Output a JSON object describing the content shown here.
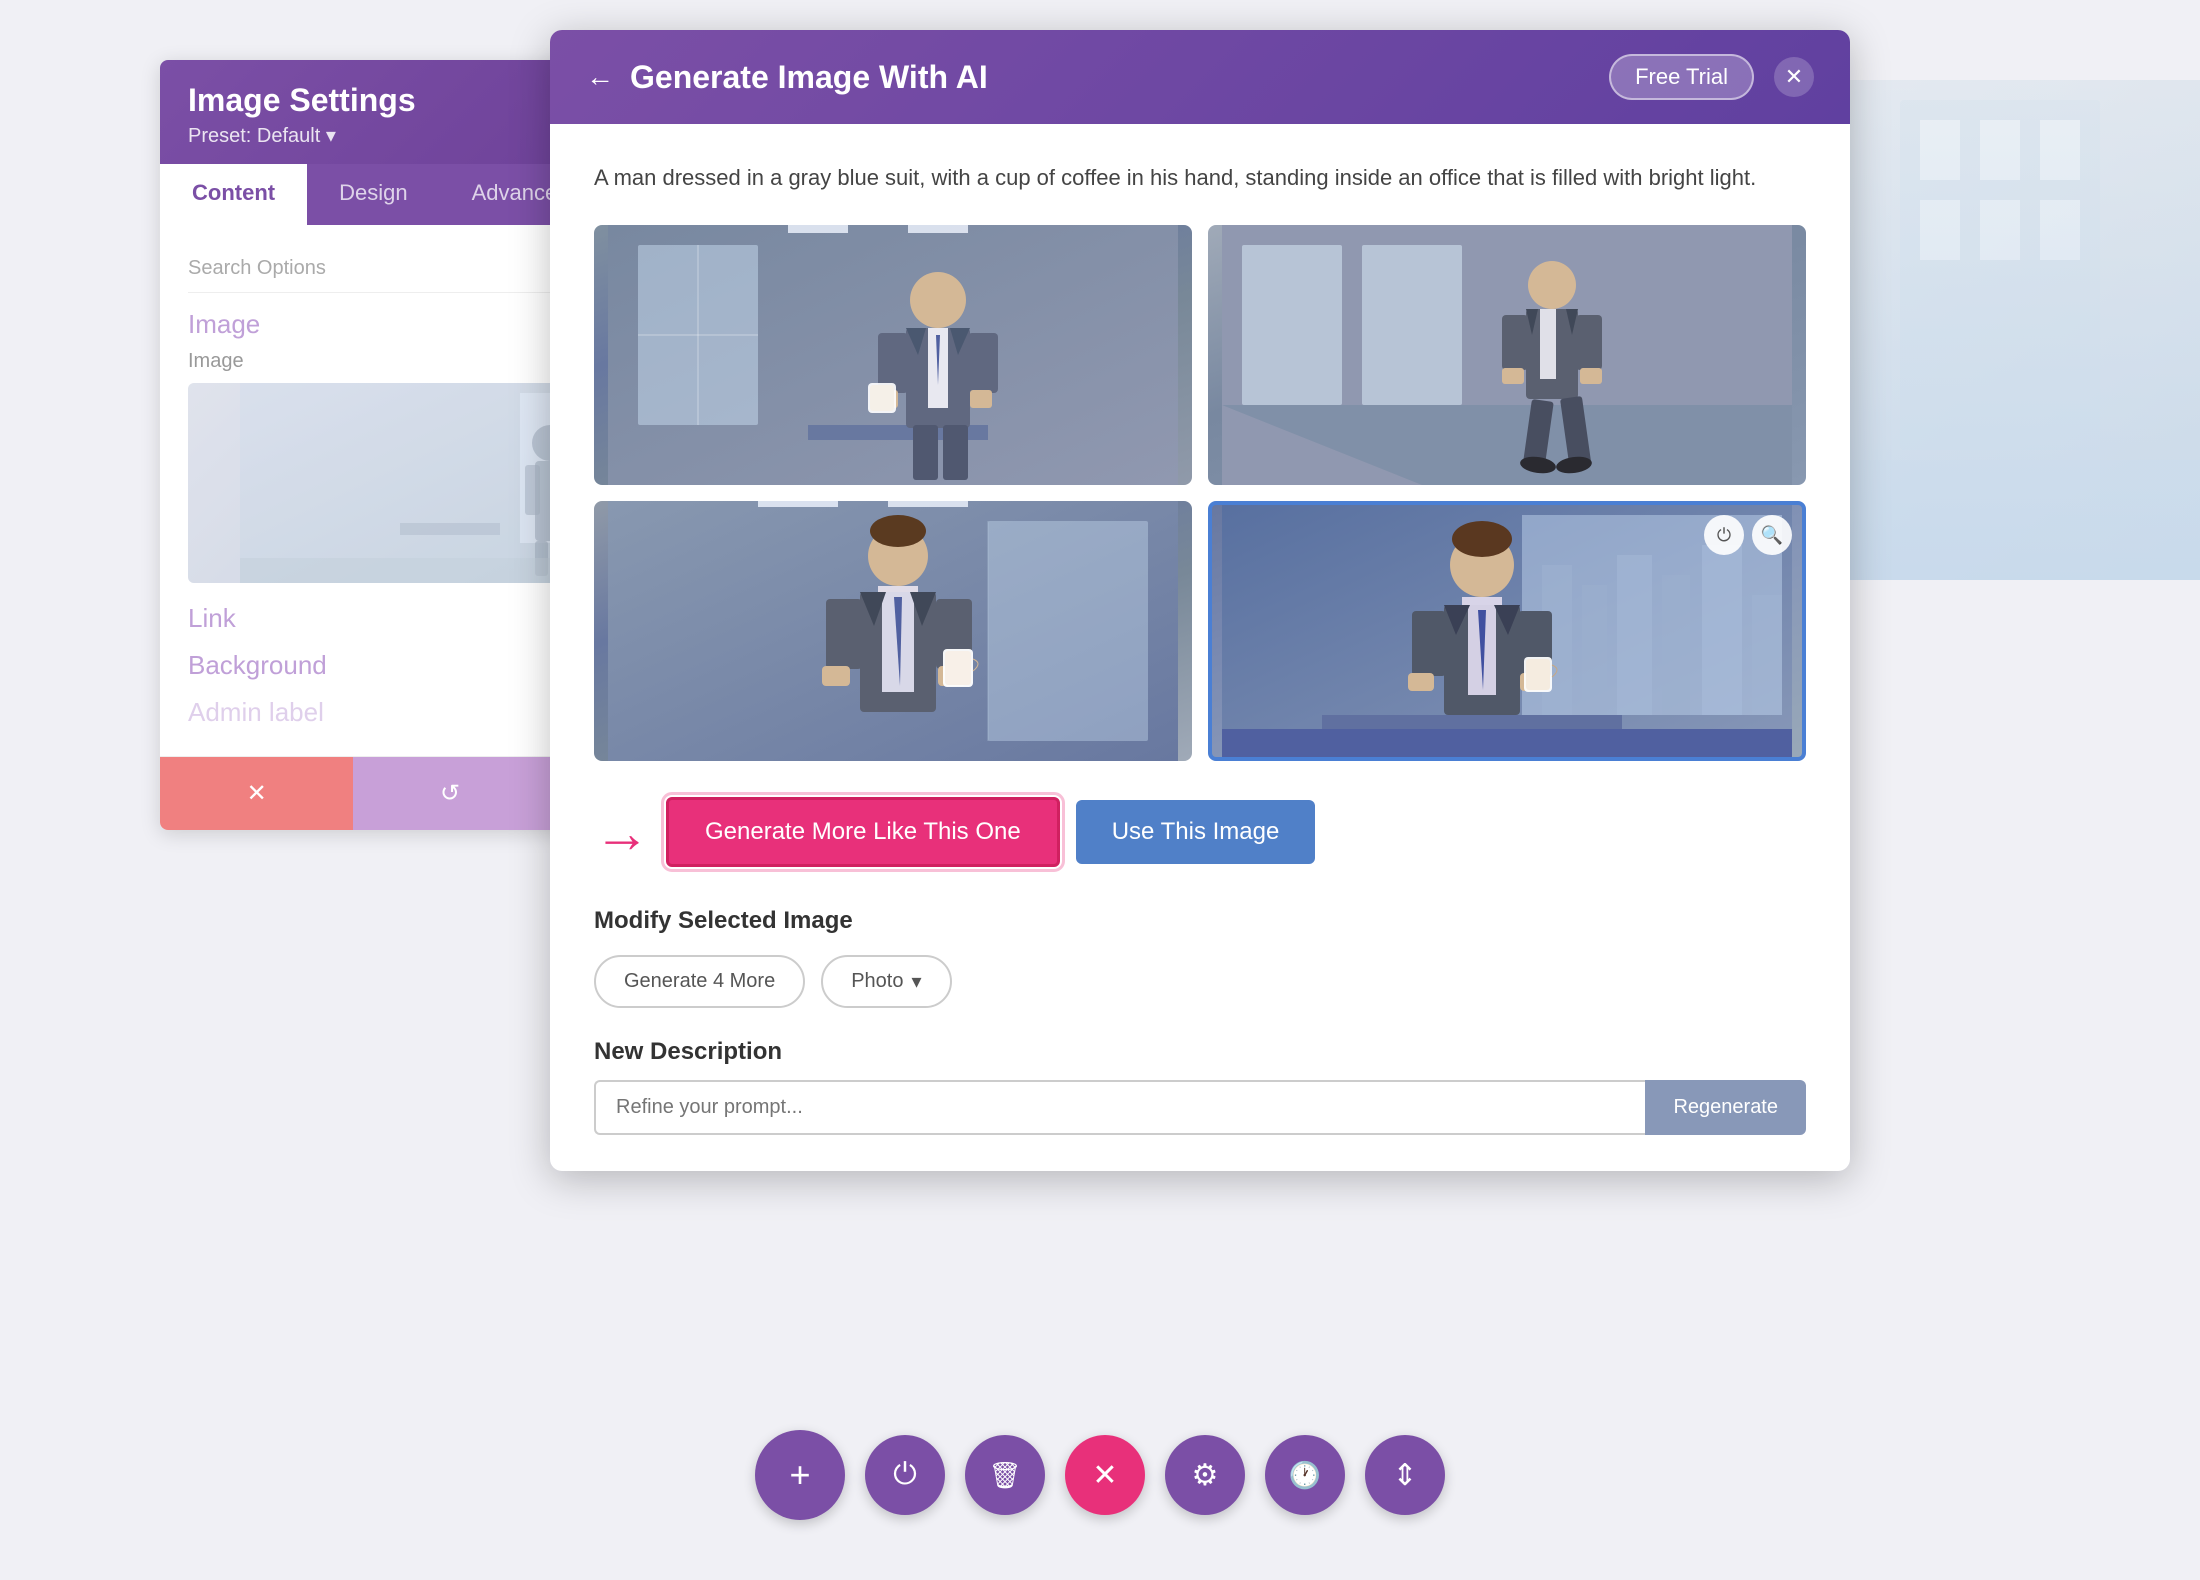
{
  "page": {
    "background_color": "#e8e8f0"
  },
  "image_settings_panel": {
    "title": "Image Settings",
    "preset_label": "Preset: Default",
    "preset_arrow": "▾",
    "tabs": [
      {
        "id": "content",
        "label": "Content",
        "active": true
      },
      {
        "id": "design",
        "label": "Design",
        "active": false
      },
      {
        "id": "advanced",
        "label": "Advanced",
        "active": false
      }
    ],
    "search_placeholder": "Search Options",
    "sections": [
      {
        "id": "image",
        "label": "Image"
      },
      {
        "id": "link",
        "label": "Link"
      },
      {
        "id": "background",
        "label": "Background"
      },
      {
        "id": "admin",
        "label": "Admin label"
      }
    ],
    "image_subsection_label": "Image",
    "toolbar_buttons": [
      {
        "id": "cancel",
        "icon": "✕",
        "type": "red"
      },
      {
        "id": "undo",
        "icon": "↺",
        "type": "purple-light"
      },
      {
        "id": "redo",
        "icon": "↻",
        "type": "purple-light"
      }
    ]
  },
  "ai_modal": {
    "title": "Generate Image With AI",
    "back_icon": "←",
    "free_trial_label": "Free Trial",
    "close_icon": "✕",
    "prompt_text": "A man dressed in a gray blue suit, with a cup of coffee in his hand, standing inside an office that is filled with bright light.",
    "images": [
      {
        "id": 1,
        "alt": "Man in suit holding coffee in office",
        "selected": false
      },
      {
        "id": 2,
        "alt": "Man in suit walking in office corridor",
        "selected": false
      },
      {
        "id": 3,
        "alt": "Man in suit holding coffee cup close up",
        "selected": false
      },
      {
        "id": 4,
        "alt": "Man in suit in office with city view",
        "selected": true
      }
    ],
    "selected_image_overlay": {
      "power_icon": "⏻",
      "search_icon": "🔍"
    },
    "action_buttons": {
      "generate_more_label": "Generate More Like This One",
      "use_image_label": "Use This Image"
    },
    "modify_section": {
      "heading": "Modify Selected Image",
      "generate_4_label": "Generate 4 More",
      "style_label": "Photo",
      "style_dropdown_arrow": "▾"
    },
    "new_description": {
      "heading": "New Description",
      "input_placeholder": "Refine your prompt...",
      "regenerate_label": "Regenerate"
    }
  },
  "divi_toolbar": {
    "buttons": [
      {
        "id": "add",
        "icon": "+",
        "large": true
      },
      {
        "id": "power",
        "icon": "⏻",
        "large": false
      },
      {
        "id": "trash",
        "icon": "🗑",
        "large": false
      },
      {
        "id": "close",
        "icon": "✕",
        "large": false,
        "pink": true
      },
      {
        "id": "settings",
        "icon": "⚙",
        "large": false
      },
      {
        "id": "history",
        "icon": "🕐",
        "large": false
      },
      {
        "id": "columns",
        "icon": "⇕",
        "large": false
      }
    ]
  }
}
